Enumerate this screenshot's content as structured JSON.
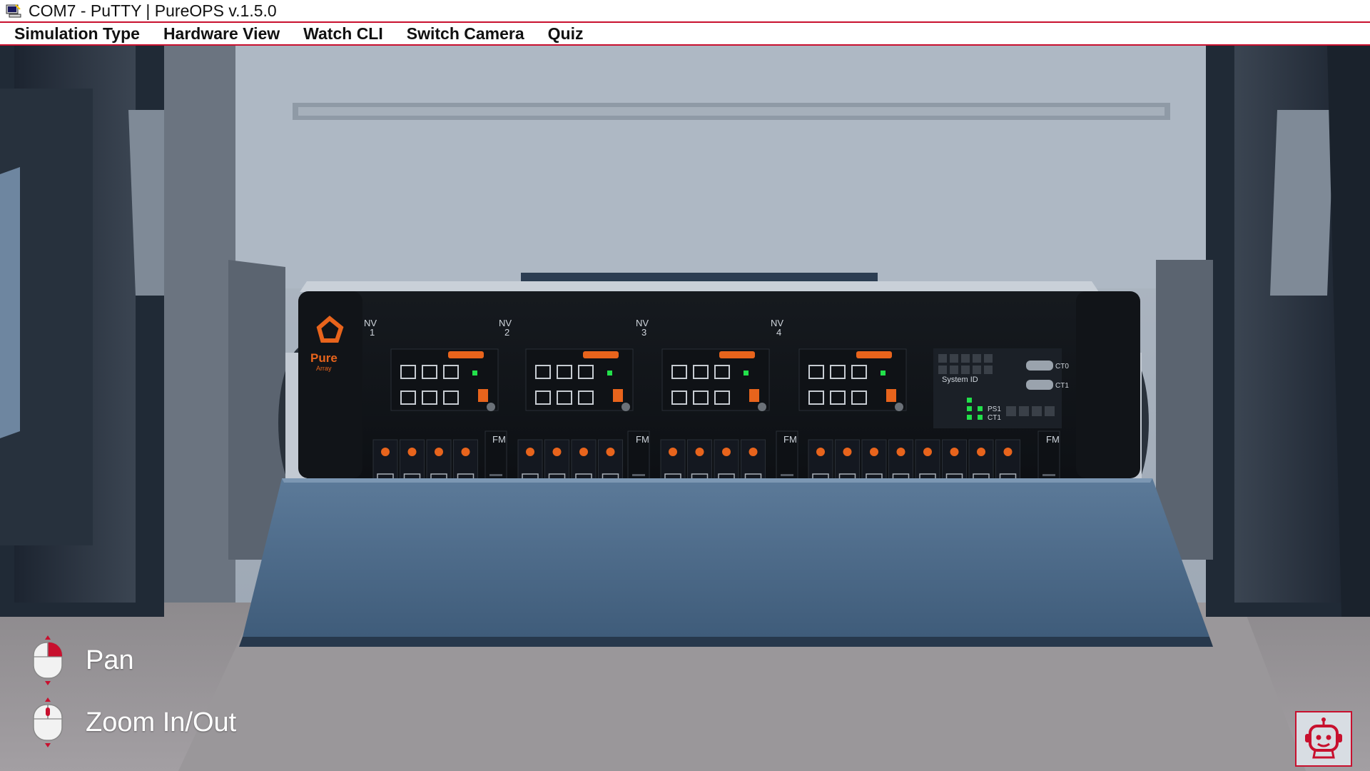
{
  "window": {
    "title": "COM7 - PuTTY | PureOPS v.1.5.0",
    "icon": "putty-terminal-icon"
  },
  "menu": {
    "items": [
      {
        "label": "Simulation Type"
      },
      {
        "label": "Hardware View"
      },
      {
        "label": "Watch CLI"
      },
      {
        "label": "Switch Camera"
      },
      {
        "label": "Quiz"
      }
    ]
  },
  "array": {
    "brand": "Pure",
    "model": "Array",
    "nv_labels": [
      "NV",
      "NV",
      "NV",
      "NV"
    ],
    "nv_numbers": [
      "1",
      "2",
      "3",
      "4"
    ],
    "fm_labels": [
      "FM",
      "FM",
      "FM",
      "FM"
    ],
    "system_id_label": "System ID",
    "ps_labels": [
      "PS1",
      "CT1"
    ],
    "ct_labels": [
      "CT0",
      "CT1"
    ],
    "led_color": "#22e04a",
    "accent_color": "#e8641c"
  },
  "hints": [
    {
      "label": "Pan",
      "icon": "mouse-right-click-icon"
    },
    {
      "label": "Zoom In/Out",
      "icon": "mouse-scroll-icon"
    }
  ],
  "assistant": {
    "icon": "robot-assistant-icon"
  },
  "colors": {
    "accent": "#c8102e"
  }
}
